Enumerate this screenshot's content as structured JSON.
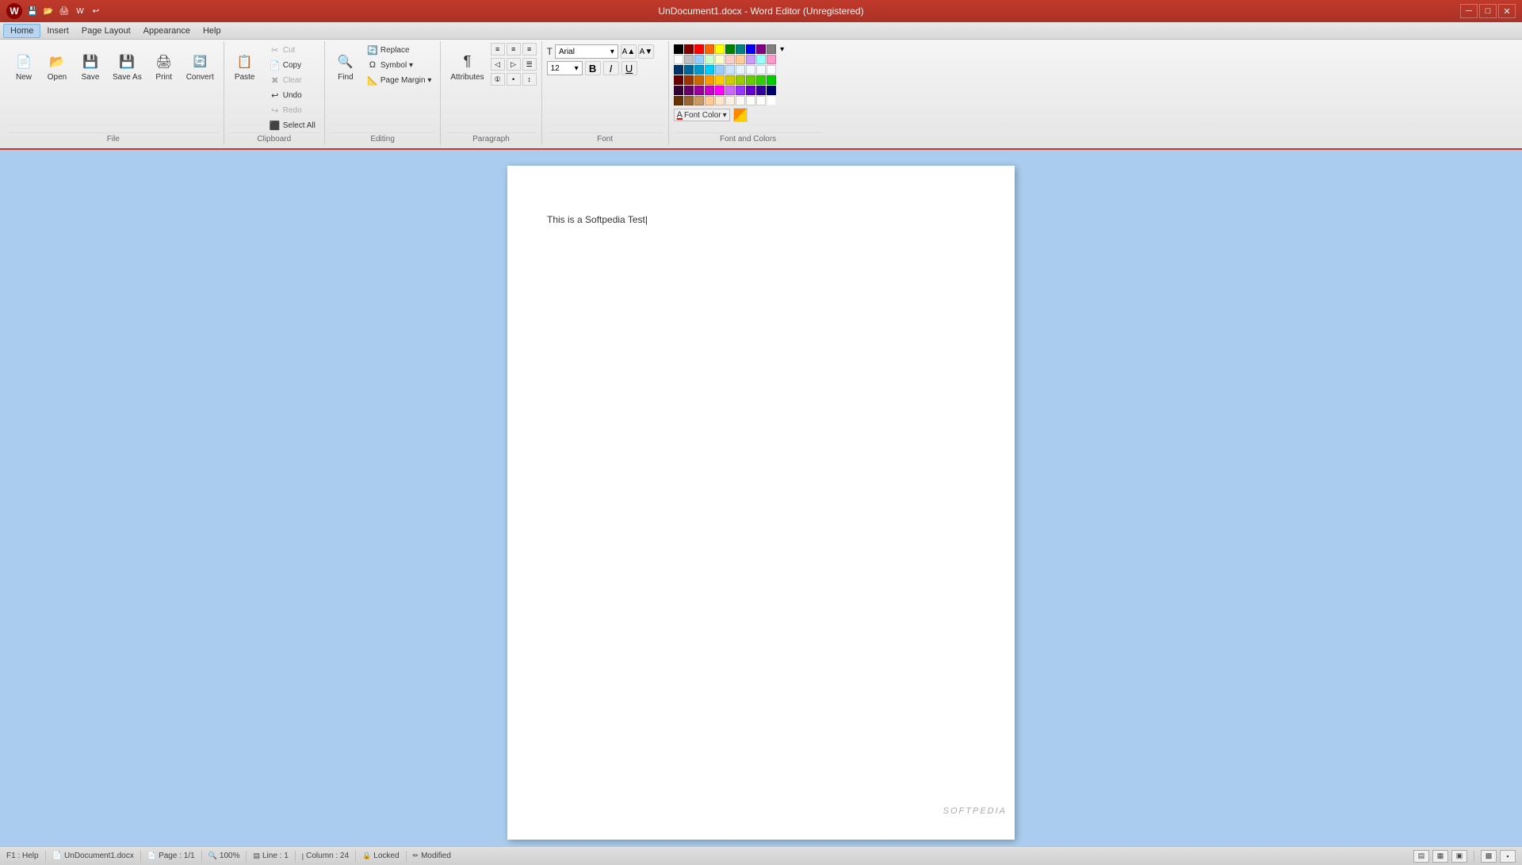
{
  "titleBar": {
    "title": "UnDocument1.docx - Word Editor (Unregistered)",
    "appLogo": "W"
  },
  "quickAccess": {
    "buttons": [
      "💾",
      "📂",
      "💾",
      "🖨",
      "W",
      "↩"
    ]
  },
  "menuBar": {
    "items": [
      "Home",
      "Insert",
      "Page Layout",
      "Appearance",
      "Help"
    ]
  },
  "ribbon": {
    "groups": [
      {
        "name": "file",
        "label": "File",
        "buttons": [
          {
            "id": "new",
            "label": "New",
            "icon": "📄",
            "type": "large"
          },
          {
            "id": "open",
            "label": "Open",
            "icon": "📂",
            "type": "large"
          },
          {
            "id": "save",
            "label": "Save",
            "icon": "💾",
            "type": "large"
          },
          {
            "id": "save-as",
            "label": "Save As",
            "icon": "💾",
            "type": "large"
          },
          {
            "id": "print",
            "label": "Print",
            "icon": "🖨",
            "type": "large"
          },
          {
            "id": "convert",
            "label": "Convert",
            "icon": "🔄",
            "type": "large"
          }
        ]
      },
      {
        "name": "clipboard",
        "label": "Clipboard",
        "buttons": [
          {
            "id": "paste",
            "label": "Paste",
            "icon": "📋",
            "type": "large"
          },
          {
            "id": "cut",
            "label": "Cut",
            "icon": "✂",
            "type": "small"
          },
          {
            "id": "copy",
            "label": "Copy",
            "icon": "📄",
            "type": "small"
          },
          {
            "id": "clear",
            "label": "Clear",
            "icon": "✖",
            "type": "small"
          },
          {
            "id": "undo",
            "label": "Undo",
            "icon": "↩",
            "type": "small"
          },
          {
            "id": "redo",
            "label": "Redo",
            "icon": "↪",
            "type": "small"
          },
          {
            "id": "select-all",
            "label": "Select All",
            "icon": "⬛",
            "type": "small"
          }
        ]
      },
      {
        "name": "editing",
        "label": "Editing",
        "buttons": [
          {
            "id": "find",
            "label": "Find",
            "icon": "🔍",
            "type": "large"
          },
          {
            "id": "replace",
            "label": "Replace",
            "icon": "🔄",
            "type": "small"
          },
          {
            "id": "symbol",
            "label": "Symbol",
            "icon": "Ω",
            "type": "small"
          },
          {
            "id": "page-margin",
            "label": "Page Margin",
            "icon": "📐",
            "type": "small"
          }
        ]
      },
      {
        "name": "paragraph",
        "label": "Paragraph",
        "buttons": [
          {
            "id": "attributes",
            "label": "Attributes",
            "icon": "¶",
            "type": "large"
          },
          {
            "id": "align-left",
            "label": "Align Left",
            "icon": "≡",
            "type": "small"
          },
          {
            "id": "align-center",
            "label": "Align Center",
            "icon": "≡",
            "type": "small"
          },
          {
            "id": "align-right",
            "label": "Align Right",
            "icon": "≡",
            "type": "small"
          },
          {
            "id": "justify",
            "label": "Justify",
            "icon": "≡",
            "type": "small"
          },
          {
            "id": "indent-dec",
            "label": "Decrease Indent",
            "icon": "←",
            "type": "small"
          },
          {
            "id": "indent-inc",
            "label": "Increase Indent",
            "icon": "→",
            "type": "small"
          }
        ]
      },
      {
        "name": "font",
        "label": "Font",
        "fontName": "Arial",
        "fontSize": "12",
        "buttons": [
          {
            "id": "bold",
            "label": "B",
            "style": "bold"
          },
          {
            "id": "italic",
            "label": "I",
            "style": "italic"
          },
          {
            "id": "underline",
            "label": "U",
            "style": "underline"
          },
          {
            "id": "font-size-up",
            "label": "A↑"
          },
          {
            "id": "font-size-dn",
            "label": "A↓"
          }
        ]
      },
      {
        "name": "font-and-colors",
        "label": "Font and Colors",
        "fontColor": "Font Color",
        "swatchRows": [
          [
            "#000000",
            "#800000",
            "#ff0000",
            "#ff6600",
            "#ffff00",
            "#008000",
            "#008080",
            "#0000ff",
            "#800080",
            "#808080"
          ],
          [
            "#ffffff",
            "#c0c0c0",
            "#99ccff",
            "#ccffcc",
            "#ffffcc",
            "#ffcccc",
            "#ffcc99",
            "#cc99ff",
            "#99ffff",
            "#ff99cc"
          ],
          [
            "#003366",
            "#006699",
            "#0099cc",
            "#00ccff",
            "#99ccff",
            "#cce5ff",
            "#e5f2ff",
            "#f0f8ff",
            "#f5faff",
            "#fafcff"
          ],
          [
            "#660000",
            "#993300",
            "#cc6600",
            "#ff9900",
            "#ffcc00",
            "#cccc00",
            "#99cc00",
            "#66cc00",
            "#33cc00",
            "#00cc00"
          ],
          [
            "#330033",
            "#660066",
            "#990099",
            "#cc00cc",
            "#ff00ff",
            "#cc66ff",
            "#9933ff",
            "#6600cc",
            "#330099",
            "#000066"
          ],
          [
            "#663300",
            "#996633",
            "#cc9966",
            "#ffcc99",
            "#ffe5cc",
            "#fff0e5",
            "#fffaf5",
            "#fffdfa",
            "#fffffe",
            "#ffffff"
          ]
        ]
      }
    ]
  },
  "document": {
    "text": "This is a Softpedia Test|",
    "page": "1",
    "totalPages": "1",
    "zoom": "100%",
    "line": "1",
    "column": "24"
  },
  "statusBar": {
    "help": "F1 : Help",
    "filename": "UnDocument1.docx",
    "page": "Page : 1/1",
    "zoom": "100%",
    "line": "Line : 1",
    "column": "Column : 24",
    "locked": "Locked",
    "modified": "Modified"
  },
  "watermark": "SOFTPEDIA"
}
